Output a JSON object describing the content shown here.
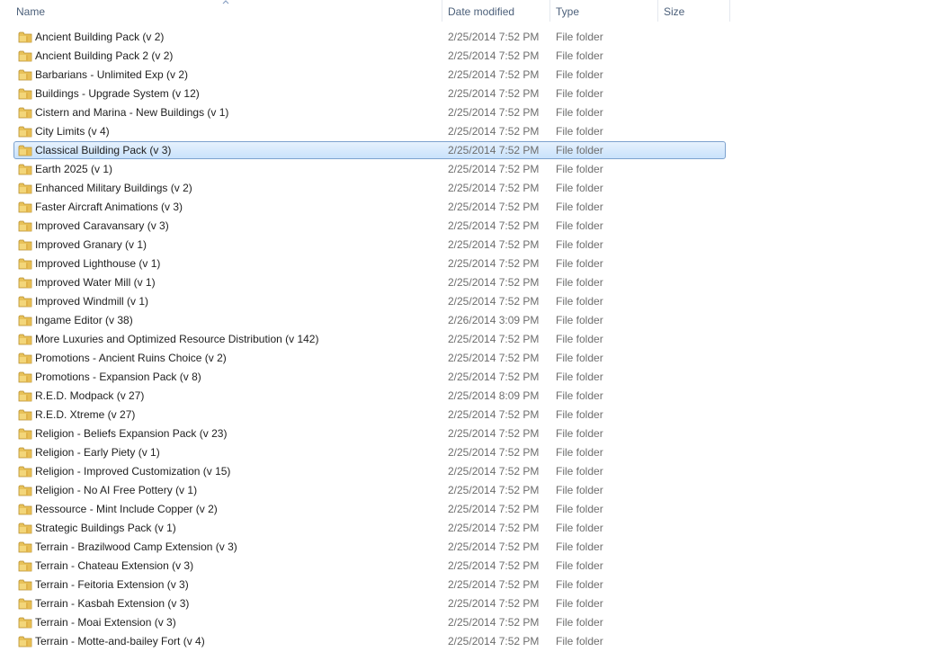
{
  "columns": {
    "name": "Name",
    "date": "Date modified",
    "type": "Type",
    "size": "Size"
  },
  "selected_index": 6,
  "rows": [
    {
      "name": "Ancient Building Pack (v 2)",
      "date": "2/25/2014 7:52 PM",
      "type": "File folder",
      "size": ""
    },
    {
      "name": "Ancient Building Pack 2 (v 2)",
      "date": "2/25/2014 7:52 PM",
      "type": "File folder",
      "size": ""
    },
    {
      "name": "Barbarians - Unlimited Exp (v 2)",
      "date": "2/25/2014 7:52 PM",
      "type": "File folder",
      "size": ""
    },
    {
      "name": "Buildings - Upgrade System (v 12)",
      "date": "2/25/2014 7:52 PM",
      "type": "File folder",
      "size": ""
    },
    {
      "name": "Cistern and Marina - New Buildings (v 1)",
      "date": "2/25/2014 7:52 PM",
      "type": "File folder",
      "size": ""
    },
    {
      "name": "City Limits (v 4)",
      "date": "2/25/2014 7:52 PM",
      "type": "File folder",
      "size": ""
    },
    {
      "name": "Classical Building Pack (v 3)",
      "date": "2/25/2014 7:52 PM",
      "type": "File folder",
      "size": ""
    },
    {
      "name": "Earth 2025 (v 1)",
      "date": "2/25/2014 7:52 PM",
      "type": "File folder",
      "size": ""
    },
    {
      "name": "Enhanced Military Buildings (v 2)",
      "date": "2/25/2014 7:52 PM",
      "type": "File folder",
      "size": ""
    },
    {
      "name": "Faster Aircraft Animations (v 3)",
      "date": "2/25/2014 7:52 PM",
      "type": "File folder",
      "size": ""
    },
    {
      "name": "Improved Caravansary (v 3)",
      "date": "2/25/2014 7:52 PM",
      "type": "File folder",
      "size": ""
    },
    {
      "name": "Improved Granary (v 1)",
      "date": "2/25/2014 7:52 PM",
      "type": "File folder",
      "size": ""
    },
    {
      "name": "Improved Lighthouse (v 1)",
      "date": "2/25/2014 7:52 PM",
      "type": "File folder",
      "size": ""
    },
    {
      "name": "Improved Water Mill (v 1)",
      "date": "2/25/2014 7:52 PM",
      "type": "File folder",
      "size": ""
    },
    {
      "name": "Improved Windmill (v 1)",
      "date": "2/25/2014 7:52 PM",
      "type": "File folder",
      "size": ""
    },
    {
      "name": "Ingame Editor (v 38)",
      "date": "2/26/2014 3:09 PM",
      "type": "File folder",
      "size": ""
    },
    {
      "name": "More Luxuries and Optimized Resource Distribution (v 142)",
      "date": "2/25/2014 7:52 PM",
      "type": "File folder",
      "size": ""
    },
    {
      "name": "Promotions - Ancient Ruins Choice (v 2)",
      "date": "2/25/2014 7:52 PM",
      "type": "File folder",
      "size": ""
    },
    {
      "name": "Promotions - Expansion Pack (v 8)",
      "date": "2/25/2014 7:52 PM",
      "type": "File folder",
      "size": ""
    },
    {
      "name": "R.E.D. Modpack (v 27)",
      "date": "2/25/2014 8:09 PM",
      "type": "File folder",
      "size": ""
    },
    {
      "name": "R.E.D. Xtreme (v 27)",
      "date": "2/25/2014 7:52 PM",
      "type": "File folder",
      "size": ""
    },
    {
      "name": "Religion - Beliefs Expansion Pack (v 23)",
      "date": "2/25/2014 7:52 PM",
      "type": "File folder",
      "size": ""
    },
    {
      "name": "Religion - Early Piety (v 1)",
      "date": "2/25/2014 7:52 PM",
      "type": "File folder",
      "size": ""
    },
    {
      "name": "Religion - Improved Customization (v 15)",
      "date": "2/25/2014 7:52 PM",
      "type": "File folder",
      "size": ""
    },
    {
      "name": "Religion - No AI Free Pottery (v 1)",
      "date": "2/25/2014 7:52 PM",
      "type": "File folder",
      "size": ""
    },
    {
      "name": "Ressource - Mint Include Copper (v 2)",
      "date": "2/25/2014 7:52 PM",
      "type": "File folder",
      "size": ""
    },
    {
      "name": "Strategic Buildings Pack (v 1)",
      "date": "2/25/2014 7:52 PM",
      "type": "File folder",
      "size": ""
    },
    {
      "name": "Terrain - Brazilwood Camp Extension (v 3)",
      "date": "2/25/2014 7:52 PM",
      "type": "File folder",
      "size": ""
    },
    {
      "name": "Terrain - Chateau Extension (v 3)",
      "date": "2/25/2014 7:52 PM",
      "type": "File folder",
      "size": ""
    },
    {
      "name": "Terrain - Feitoria Extension (v 3)",
      "date": "2/25/2014 7:52 PM",
      "type": "File folder",
      "size": ""
    },
    {
      "name": "Terrain - Kasbah Extension (v 3)",
      "date": "2/25/2014 7:52 PM",
      "type": "File folder",
      "size": ""
    },
    {
      "name": "Terrain - Moai Extension (v 3)",
      "date": "2/25/2014 7:52 PM",
      "type": "File folder",
      "size": ""
    },
    {
      "name": "Terrain - Motte-and-bailey Fort (v 4)",
      "date": "2/25/2014 7:52 PM",
      "type": "File folder",
      "size": ""
    }
  ],
  "icons": {
    "row_icon": "folder-icon",
    "sort_indicator": "sort-ascending-arrow-icon"
  }
}
